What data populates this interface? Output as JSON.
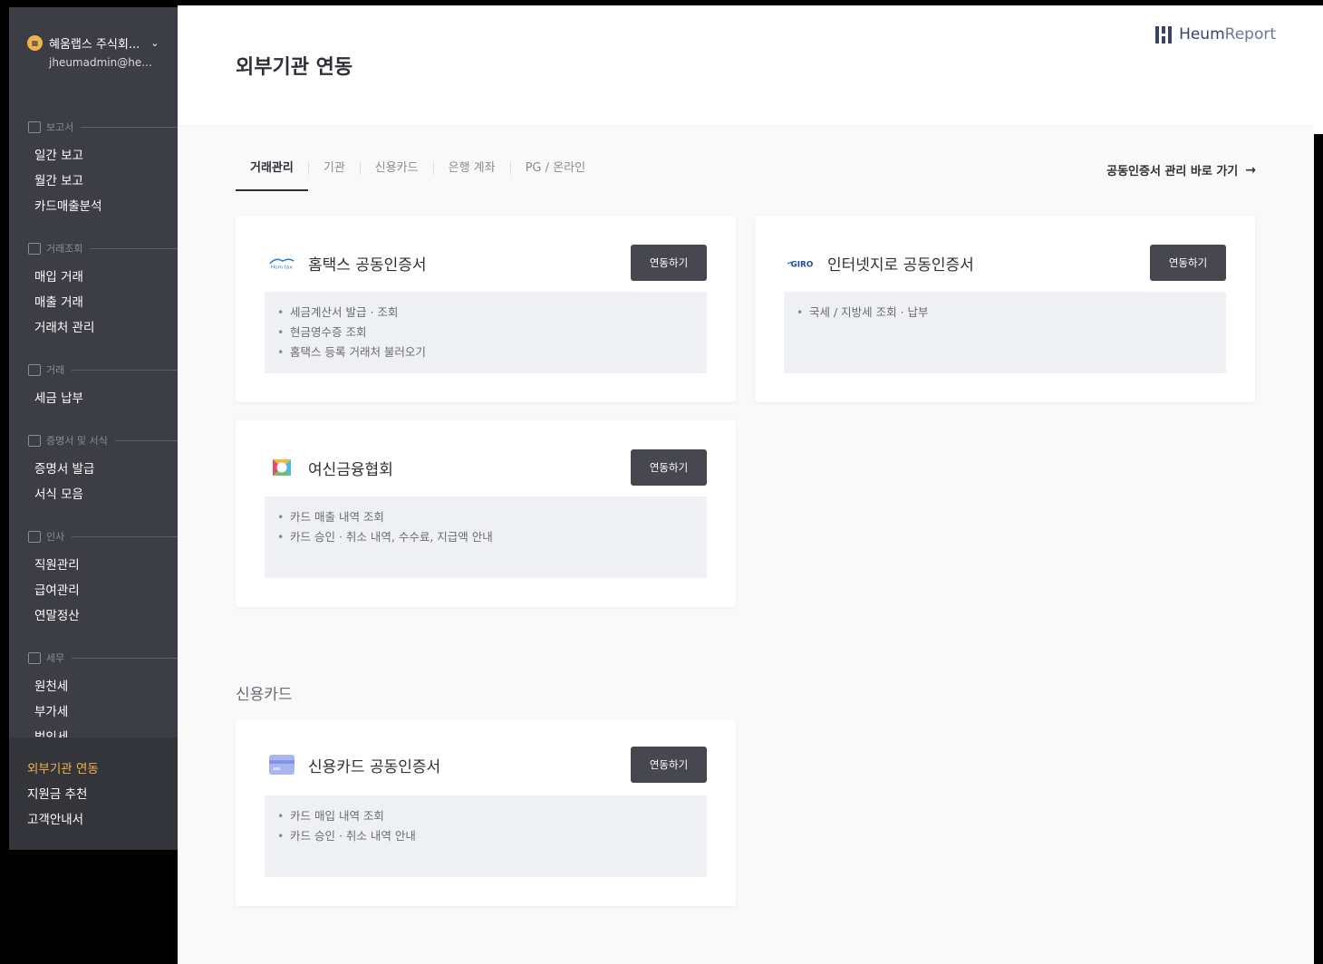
{
  "sidebar": {
    "org_icon": "building-icon",
    "org_name": "혜움랩스 주식회...",
    "org_email": "jheumadmin@he...",
    "sections": [
      {
        "title": "보고서",
        "icon": "chart-icon",
        "items": [
          "일간 보고",
          "월간 보고",
          "카드매출분석"
        ]
      },
      {
        "title": "거래조회",
        "icon": "trend-icon",
        "items": [
          "매입 거래",
          "매출 거래",
          "거래처 관리"
        ]
      },
      {
        "title": "거래",
        "icon": "transfer-icon",
        "items": [
          "세금 납부"
        ]
      },
      {
        "title": "증명서 및 서식",
        "icon": "document-icon",
        "items": [
          "증명서 발급",
          "서식 모음"
        ]
      },
      {
        "title": "인사",
        "icon": "person-icon",
        "items": [
          "직원관리",
          "급여관리",
          "연말정산"
        ]
      },
      {
        "title": "세무",
        "icon": "calculator-icon",
        "items": [
          "원천세",
          "부가세",
          "법인세"
        ]
      }
    ],
    "bottom": [
      {
        "label": "외부기관 연동",
        "active": true
      },
      {
        "label": "지원금 추천",
        "active": false
      },
      {
        "label": "고객안내서",
        "active": false
      }
    ],
    "accent_color": "#f0b24d"
  },
  "header": {
    "title": "외부기관 연동",
    "logo_bold": "Heum",
    "logo_light": "Report"
  },
  "tabs": [
    "거래관리",
    "기관",
    "신용카드",
    "은행 계좌",
    "PG / 온라인"
  ],
  "active_tab": "거래관리",
  "cert_link": "공동인증서 관리 바로 가기",
  "cards": [
    {
      "title": "홈택스 공동인증서",
      "button": "연동하기",
      "logo": "hometax-logo",
      "items": [
        "세금계산서 발급 · 조회",
        "현금영수증 조회",
        "홈택스 등록 거래처 불러오기"
      ]
    },
    {
      "title": "인터넷지로 공동인증서",
      "button": "연동하기",
      "logo": "giro-logo",
      "items": [
        "국세 / 지방세 조회 · 납부"
      ]
    },
    {
      "title": "여신금융협회",
      "button": "연동하기",
      "logo": "crefia-logo",
      "items": [
        "카드 매출 내역 조회",
        "카드 승인 · 취소 내역, 수수료, 지급액 안내"
      ]
    }
  ],
  "credit_section": {
    "title": "신용카드",
    "card": {
      "title": "신용카드 공동인증서",
      "button": "연동하기",
      "logo": "credit-card-icon",
      "items": [
        "카드 매입 내역 조회",
        "카드 승인 · 취소 내역 안내"
      ]
    }
  }
}
